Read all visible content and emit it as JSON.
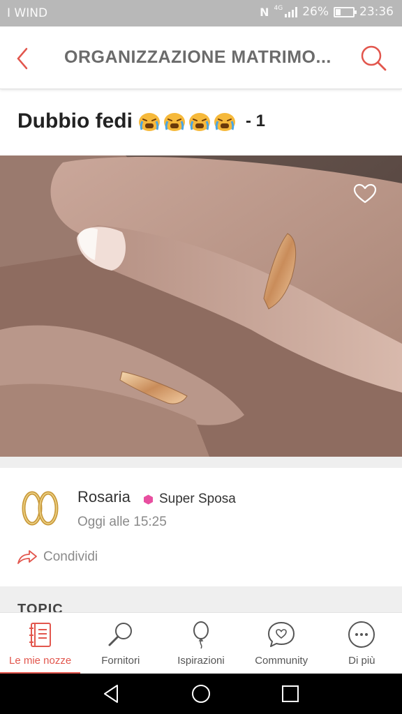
{
  "status": {
    "carrier": "I WIND",
    "network": "4G",
    "battery_level": "26%",
    "battery_fraction": 0.26,
    "time": "23:36"
  },
  "app_bar": {
    "title": "ORGANIZZAZIONE MATRIMO...",
    "back_icon": "chevron-left-icon",
    "search_icon": "search-icon"
  },
  "post": {
    "title": "Dubbio fedi",
    "emoji_icon": "crying-face-emoji",
    "emoji_count": 4,
    "page_label": "- 1",
    "photo_subject": "hands-with-wedding-rings-photo",
    "like_icon": "heart-outline-icon"
  },
  "author": {
    "name": "Rosaria",
    "avatar_icon": "wedding-rings-avatar",
    "badge": "Super Sposa",
    "badge_color": "#e84fa0",
    "time": "Oggi alle 15:25",
    "share_label": "Condividi"
  },
  "section": {
    "label": "TOPIC"
  },
  "tabs": [
    {
      "label": "Le mie nozze",
      "icon": "planner-book-icon",
      "active": true
    },
    {
      "label": "Fornitori",
      "icon": "magnifier-icon",
      "active": false
    },
    {
      "label": "Ispirazioni",
      "icon": "balloon-icon",
      "active": false
    },
    {
      "label": "Community",
      "icon": "chat-heart-icon",
      "active": false
    },
    {
      "label": "Di più",
      "icon": "more-dots-icon",
      "active": false
    }
  ],
  "colors": {
    "accent": "#e2564d",
    "status_bar": "#b8b8b8",
    "band": "#efefef"
  }
}
